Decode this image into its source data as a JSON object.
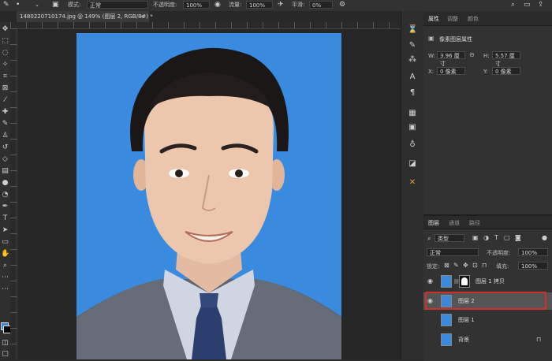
{
  "options_bar": {
    "mode_label": "模式:",
    "mode_value": "正常",
    "opacity_label": "不透明度:",
    "opacity_value": "100%",
    "flow_label": "流量:",
    "flow_value": "100%",
    "smooth_label": "平滑:",
    "smooth_value": "0%"
  },
  "document": {
    "tab_title": "1480220710174.jpg @ 149% (图层 2, RGB/8#) *",
    "close": "×"
  },
  "properties": {
    "tabs": [
      "属性",
      "调整",
      "颜色"
    ],
    "layer_type": "像素图层属性",
    "w_label": "W:",
    "w_value": "3.96 厘寸",
    "h_label": "H:",
    "h_value": "5.57 厘寸",
    "x_label": "X:",
    "x_value": "0 像素",
    "y_label": "Y:",
    "y_value": "0 像素"
  },
  "layers_panel": {
    "tabs": [
      "图层",
      "通道",
      "路径"
    ],
    "filter_kind": "类型",
    "blend_mode": "正常",
    "opacity_label": "不透明度:",
    "opacity_value": "100%",
    "lock_label": "锁定:",
    "fill_label": "填充:",
    "fill_value": "100%",
    "layers": [
      {
        "name": "图层 1 拷贝",
        "visible": true,
        "selected": false
      },
      {
        "name": "图层 2",
        "visible": true,
        "selected": true
      },
      {
        "name": "图层 1",
        "visible": false,
        "selected": false
      },
      {
        "name": "背景",
        "visible": false,
        "selected": false
      }
    ]
  },
  "colors": {
    "foreground": "#3e86d8",
    "background": "#000000",
    "selection_highlight": "#d0302a"
  }
}
